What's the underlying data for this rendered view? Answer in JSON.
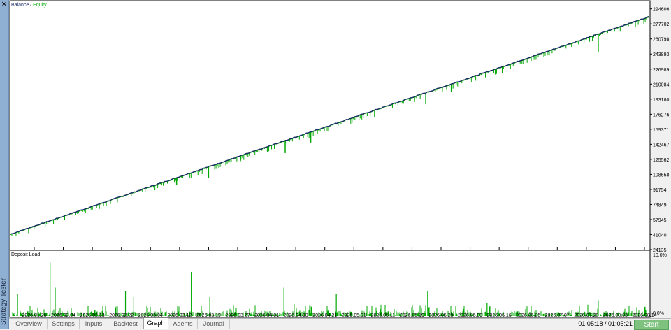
{
  "sidebar": {
    "title": "Strategy Tester",
    "close_glyph": "×"
  },
  "chart_data": [
    {
      "type": "line",
      "legend": [
        "Balance",
        "Equity"
      ],
      "legend_sep": " / ",
      "colors": {
        "balance": "#1a2a66",
        "equity": "#00a800"
      },
      "x_labels": [
        "2026.01.26",
        "2026.02.04",
        "2026.02.13",
        "2026.02.22",
        "2026.03.04",
        "2026.03.12",
        "2026.03.19",
        "2026.03.27",
        "2026.04.01",
        "2026.04.10",
        "2026.04.21",
        "2026.05.01",
        "2026.05.11",
        "2026.05.19",
        "2026.05.29",
        "2026.06.09",
        "2026.06.16",
        "2026.06.25",
        "2026.07.07",
        "2026.07.20",
        "2026.08.03",
        "2026.08.14"
      ],
      "y_ticks": [
        24135,
        41040,
        57945,
        74849,
        91754,
        108658,
        125562,
        142467,
        159371,
        176276,
        193180,
        210084,
        226989,
        243893,
        260798,
        277702,
        294606
      ],
      "ylim": [
        24135,
        303000
      ],
      "balance": {
        "start": 41500,
        "end": 286000
      },
      "equity_drawdowns": [
        {
          "at": 0.43,
          "depth": 14000
        },
        {
          "at": 0.31,
          "depth": 13000
        },
        {
          "at": 0.47,
          "depth": 12000
        },
        {
          "at": 0.65,
          "depth": 13000
        },
        {
          "at": 0.92,
          "depth": 20000
        },
        {
          "at": 0.57,
          "depth": 8000
        },
        {
          "at": 0.69,
          "depth": 9000
        },
        {
          "at": 0.77,
          "depth": 7000
        },
        {
          "at": 0.26,
          "depth": 8000
        },
        {
          "at": 0.36,
          "depth": 6000
        }
      ]
    },
    {
      "type": "bar",
      "title": "Deposit Load",
      "y_ticks": [
        "10.0%",
        "0.0%"
      ],
      "color": "#00a800",
      "ylim": [
        0,
        10
      ],
      "tall_spikes": [
        {
          "at": 0.011,
          "value": 3.5
        },
        {
          "at": 0.062,
          "value": 8.5
        },
        {
          "at": 0.07,
          "value": 4.5
        },
        {
          "at": 0.18,
          "value": 4.0
        },
        {
          "at": 0.193,
          "value": 3.0
        },
        {
          "at": 0.283,
          "value": 7.0
        },
        {
          "at": 0.312,
          "value": 3.0
        },
        {
          "at": 0.428,
          "value": 4.5
        },
        {
          "at": 0.444,
          "value": 1.9
        },
        {
          "at": 0.51,
          "value": 3.5
        },
        {
          "at": 0.653,
          "value": 4.0
        },
        {
          "at": 0.746,
          "value": 2.0
        },
        {
          "at": 0.92,
          "value": 2.5
        }
      ]
    }
  ],
  "tabs": [
    "Overview",
    "Settings",
    "Inputs",
    "Backtest",
    "Graph",
    "Agents",
    "Journal"
  ],
  "active_tab": "Graph",
  "time_status": "01:05:18 / 01:05:21",
  "start_label": "Start"
}
